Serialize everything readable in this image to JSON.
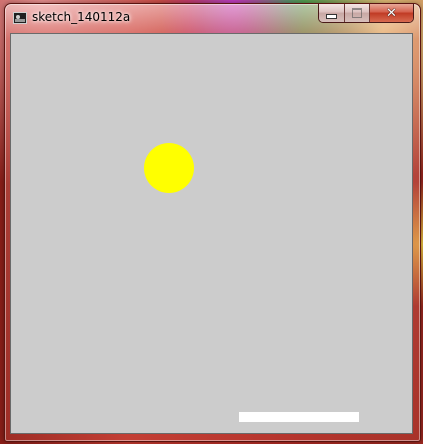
{
  "window": {
    "title": "sketch_140112a",
    "icon": "processing-app-icon",
    "buttons": {
      "minimize_icon": "minimize-icon",
      "maximize_icon": "maximize-icon",
      "close_icon": "close-icon",
      "close_glyph": "✕"
    }
  },
  "sketch": {
    "background_color": "#cccccc",
    "ball_color": "#ffff00",
    "paddle_color": "#ffffff"
  }
}
